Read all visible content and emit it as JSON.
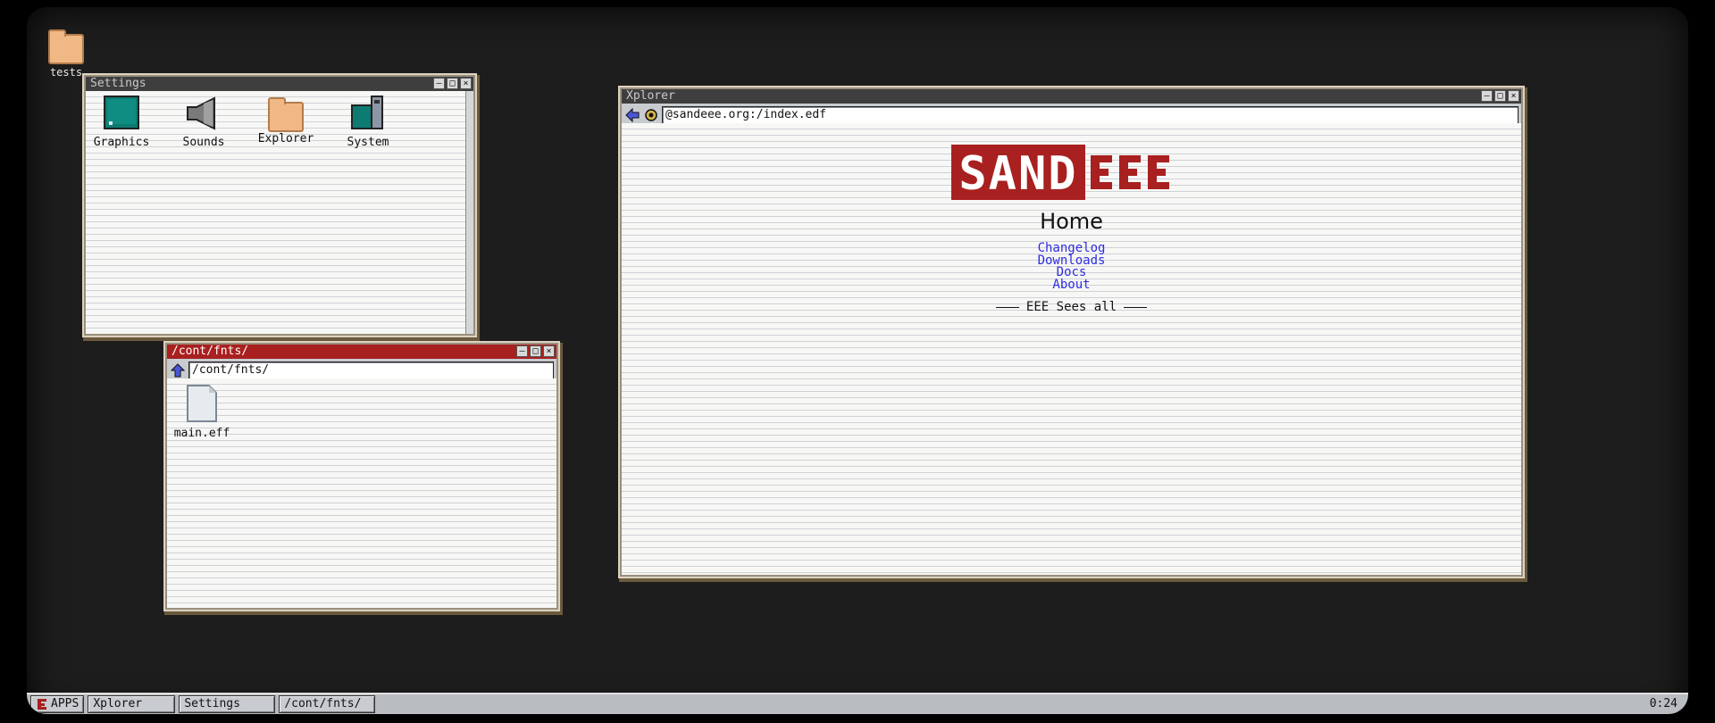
{
  "desktop": {
    "icons": [
      {
        "label": "tests",
        "icon": "folder-icon"
      }
    ]
  },
  "settings_window": {
    "title": "Settings",
    "items": [
      {
        "label": "Graphics",
        "icon": "monitor-icon"
      },
      {
        "label": "Sounds",
        "icon": "speaker-icon"
      },
      {
        "label": "Explorer",
        "icon": "folder-icon"
      },
      {
        "label": "System",
        "icon": "computer-icon"
      }
    ]
  },
  "files_window": {
    "title": "/cont/fnts/",
    "path": "/cont/fnts/",
    "files": [
      {
        "label": "main.eff",
        "icon": "file-icon"
      }
    ]
  },
  "xplorer_window": {
    "title": "Xplorer",
    "address": "@sandeee.org:/index.edf",
    "page": {
      "logo_text": "SAND EEE",
      "heading": "Home",
      "links": [
        "Changelog",
        "Downloads",
        "Docs",
        "About"
      ],
      "footer": "EEE Sees all"
    }
  },
  "window_buttons": {
    "minimize": "–",
    "maximize": "□",
    "close": "×"
  },
  "taskbar": {
    "start_label": "APPS",
    "tasks": [
      "Xplorer",
      "Settings",
      "/cont/fnts/"
    ],
    "clock": "0:24"
  },
  "colors": {
    "active_title": "#a8201f",
    "inactive_title": "#3e3e3e",
    "link": "#2c2ce0",
    "logo": "#a8201f",
    "folder": "#f0b885"
  }
}
